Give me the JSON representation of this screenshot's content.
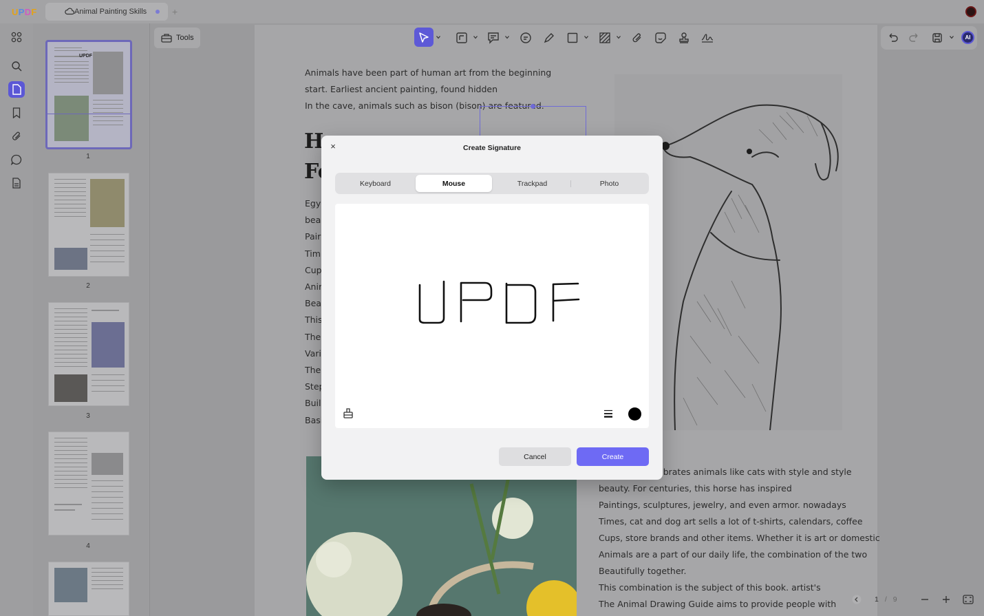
{
  "app": {
    "logo": "UPDF",
    "doc_tab": "Animal Painting Skills"
  },
  "sidebar_thumbnails": [
    {
      "page": "1"
    },
    {
      "page": "2"
    },
    {
      "page": "3"
    },
    {
      "page": "4"
    }
  ],
  "toolbar": {
    "tools_label": "Tools"
  },
  "document": {
    "intro_lines": [
      "Animals have been part of human art from the beginning",
      "start. Earliest ancient painting, found hidden",
      "In the cave, animals such as bison (bison) are featured."
    ],
    "heading_fragments": [
      "H",
      "Fo"
    ],
    "truncated_lines": [
      "Egyp",
      "bea",
      "Pair",
      "Tim",
      "Cup",
      "Anir",
      "Bea",
      "This",
      "The",
      "Vari",
      "Thei",
      "Step",
      "Buil",
      "Basi"
    ],
    "bottom_lines": [
      "ebrates animals like cats with style and style",
      "beauty. For centuries, this horse has inspired",
      "Paintings, sculptures, jewelry, and even armor. nowadays",
      "Times, cat and dog art sells a lot of t-shirts, calendars, coffee",
      "Cups, store brands and other items. Whether it is art or domestic",
      "Animals are a part of our daily life, the combination of the two",
      "Beautifully together.",
      "This combination is the subject of this book. artist's",
      "The Animal Drawing Guide aims to provide people with"
    ]
  },
  "pager": {
    "current": "1",
    "separator": "/",
    "total": "9"
  },
  "dialog": {
    "close": "×",
    "title": "Create Signature",
    "tabs": [
      "Keyboard",
      "Mouse",
      "Trackpad",
      "Photo"
    ],
    "active_tab": "Mouse",
    "signature_text": "UPDF",
    "pen_color": "#000000",
    "cancel": "Cancel",
    "create": "Create"
  },
  "colors": {
    "accent": "#6e6af4",
    "selection": "#6f6bd6"
  }
}
